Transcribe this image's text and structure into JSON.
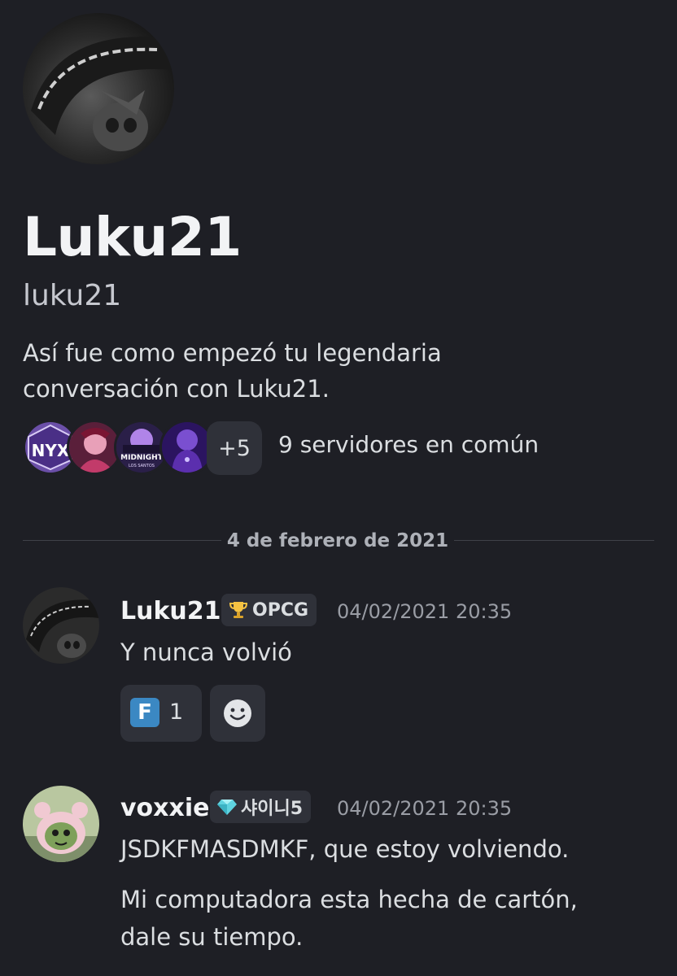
{
  "profile": {
    "display_name": "Luku21",
    "username": "luku21",
    "intro": "Así fue como empezó tu legendaria conversación con Luku21."
  },
  "mutual_servers": {
    "icons": [
      "nyx-server-icon",
      "pink-character-server-icon",
      "midnight-los-santos-server-icon",
      "purple-figure-server-icon"
    ],
    "more_label": "+5",
    "label": "9 servidores en común"
  },
  "divider": {
    "date": "4 de febrero de 2021"
  },
  "messages": [
    {
      "author": "Luku21",
      "tag": {
        "icon": "trophy-icon",
        "label": "OPCG"
      },
      "timestamp": "04/02/2021 20:35",
      "lines": [
        "Y nunca volvió"
      ],
      "reaction": {
        "emoji": "F",
        "count": "1"
      }
    },
    {
      "author": "voxxie",
      "tag": {
        "icon": "gem-icon",
        "label": "샤이니5"
      },
      "timestamp": "04/02/2021 20:35",
      "lines": [
        "JSDKFMASDMKF, que estoy volviendo.",
        "Mi computadora esta hecha de cartón,",
        "dale su tiempo."
      ]
    }
  ],
  "colors": {
    "background": "#1e1f25",
    "chip": "#2f3139",
    "reaction_f": "#3b88c3"
  }
}
